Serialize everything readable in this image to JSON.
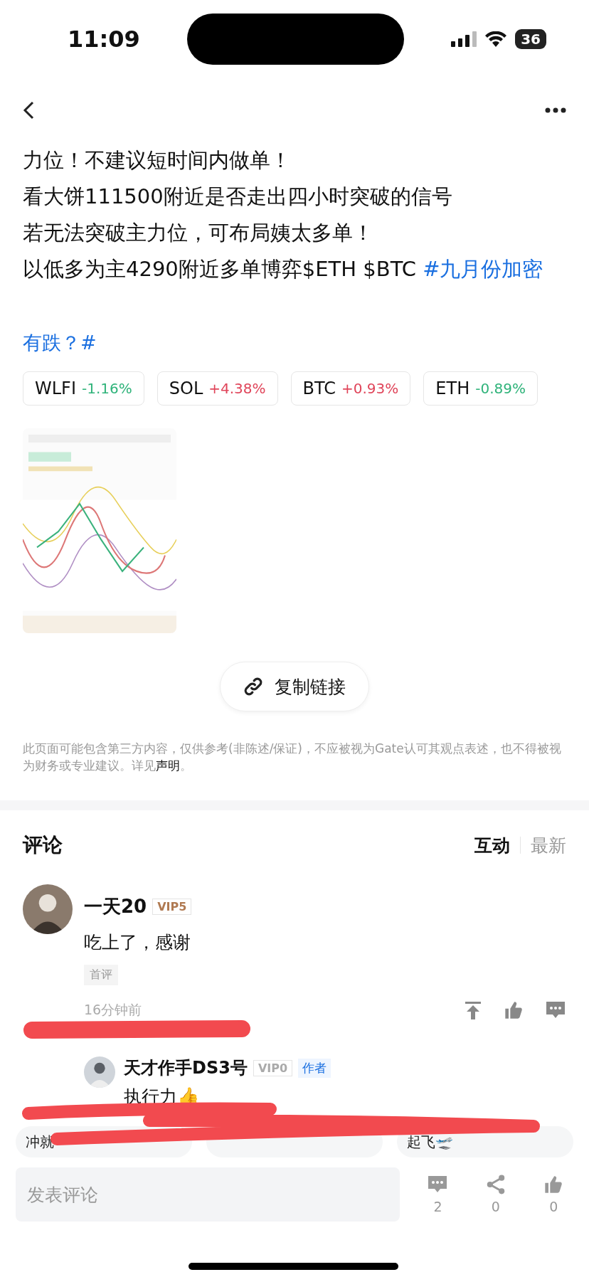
{
  "status_bar": {
    "time": "11:09",
    "battery": "36"
  },
  "post": {
    "lines": [
      "力位！不建议短时间内做单！",
      "看大饼111500附近是否走出四小时突破的信号",
      "若无法突破主力位，可布局姨太多单！",
      "以低多为主4290附近多单博弈$ETH $BTC **#九月份加密**"
    ],
    "tag_line": "有跌？#"
  },
  "tickers": [
    {
      "symbol": "WLFI",
      "change": "-1.16%",
      "color": "#2fb37a"
    },
    {
      "symbol": "SOL",
      "change": "+4.38%",
      "color": "#e0455a"
    },
    {
      "symbol": "BTC",
      "change": "+0.93%",
      "color": "#e0455a"
    },
    {
      "symbol": "ETH",
      "change": "-0.89%",
      "color": "#2fb37a"
    }
  ],
  "copy_link": "复制链接",
  "disclaimer": "此页面可能包含第三方内容，仅供参考(非陈述/保证)，不应被视为Gate认可其观点表述，也不得被视为财务或专业建议。详见",
  "disclaimer_link": "声明",
  "disclaimer_end": "。",
  "comments_header": {
    "title": "评论",
    "sorts": [
      {
        "label": "互动",
        "selected": true
      },
      {
        "label": "最新",
        "selected": false
      }
    ]
  },
  "comments": [
    {
      "name": "一天20",
      "vip": "VIP5",
      "color": "#b07a52",
      "text": "吃上了，感谢",
      "tag": "首评",
      "time": "16分钟前",
      "replies": [
        {
          "name": "天才作手DS3号",
          "vip": "VIP0",
          "color": "#aaaaaa",
          "badge": "作者",
          "text": "执行力👍"
        }
      ]
    }
  ],
  "quick_replies": [
    {
      "text": "冲就"
    },
    {
      "covered": true
    },
    {
      "text": "起飞🛫"
    }
  ],
  "bottom_bar": {
    "placeholder": "发表评论",
    "comments": "2",
    "shares": "0",
    "likes": "0"
  }
}
